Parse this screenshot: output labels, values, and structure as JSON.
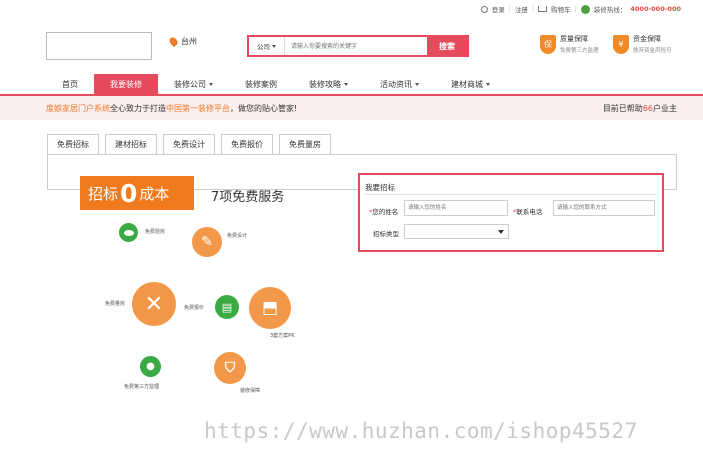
{
  "topbar": {
    "login": "登录",
    "register": "注册",
    "cart": "购物车",
    "hotline_label": "装修热线：",
    "hotline_number": "4000-000-000"
  },
  "header": {
    "city": "台州",
    "search": {
      "category": "公司",
      "placeholder": "请输入你要搜索的关键字",
      "button": "搜索"
    },
    "guarantees": [
      {
        "icon": "保",
        "title": "质量保障",
        "subtitle": "免费第三方监理"
      },
      {
        "icon": "¥",
        "title": "资金保障",
        "subtitle": "放弃资金风险可"
      }
    ]
  },
  "nav": {
    "items": [
      {
        "label": "首页",
        "dropdown": false
      },
      {
        "label": "我要装修",
        "dropdown": false
      },
      {
        "label": "装修公司",
        "dropdown": true
      },
      {
        "label": "装修案例",
        "dropdown": false
      },
      {
        "label": "装修攻略",
        "dropdown": true
      },
      {
        "label": "活动资讯",
        "dropdown": true
      },
      {
        "label": "建材商城",
        "dropdown": true
      }
    ],
    "active_index": 1
  },
  "slogan": {
    "brand": "度娘家居门户系统",
    "middle": "全心致力于打造",
    "highlight": "中国第一装修平台",
    "tail": "，做您的贴心管家!",
    "helped_prefix": "目前已帮助",
    "helped_count": "66",
    "helped_suffix": "户业主"
  },
  "tabs": [
    "免费招标",
    "建材招标",
    "免费设计",
    "免费报价",
    "免费量房"
  ],
  "promo": {
    "badge_pre": "招标",
    "badge_zero": "0",
    "badge_post": "成本",
    "headline": "7项免费服务",
    "services": [
      {
        "label": "免费验房",
        "icon": "eye-icon"
      },
      {
        "label": "免费设计",
        "icon": "pencil-icon"
      },
      {
        "label": "免费量房",
        "icon": "ruler-icon"
      },
      {
        "label": "免费报价",
        "icon": "document-icon"
      },
      {
        "label": "3套方案PK",
        "icon": "plan-icon"
      },
      {
        "label": "免费第三方监理",
        "icon": "helmet-icon"
      },
      {
        "label": "装修保障",
        "icon": "shield-icon"
      }
    ]
  },
  "form": {
    "title": "我要招标",
    "name_label": "您的姓名",
    "name_placeholder": "请输入您的姓名",
    "phone_label": "联系电话",
    "phone_placeholder": "请输入您的联系方式",
    "type_label": "招标类型",
    "type_value": ""
  },
  "watermark": "https://www.huzhan.com/ishop45527",
  "colors": {
    "accent": "#e54a5d",
    "orange": "#f07a1e",
    "green": "#3ba944"
  }
}
